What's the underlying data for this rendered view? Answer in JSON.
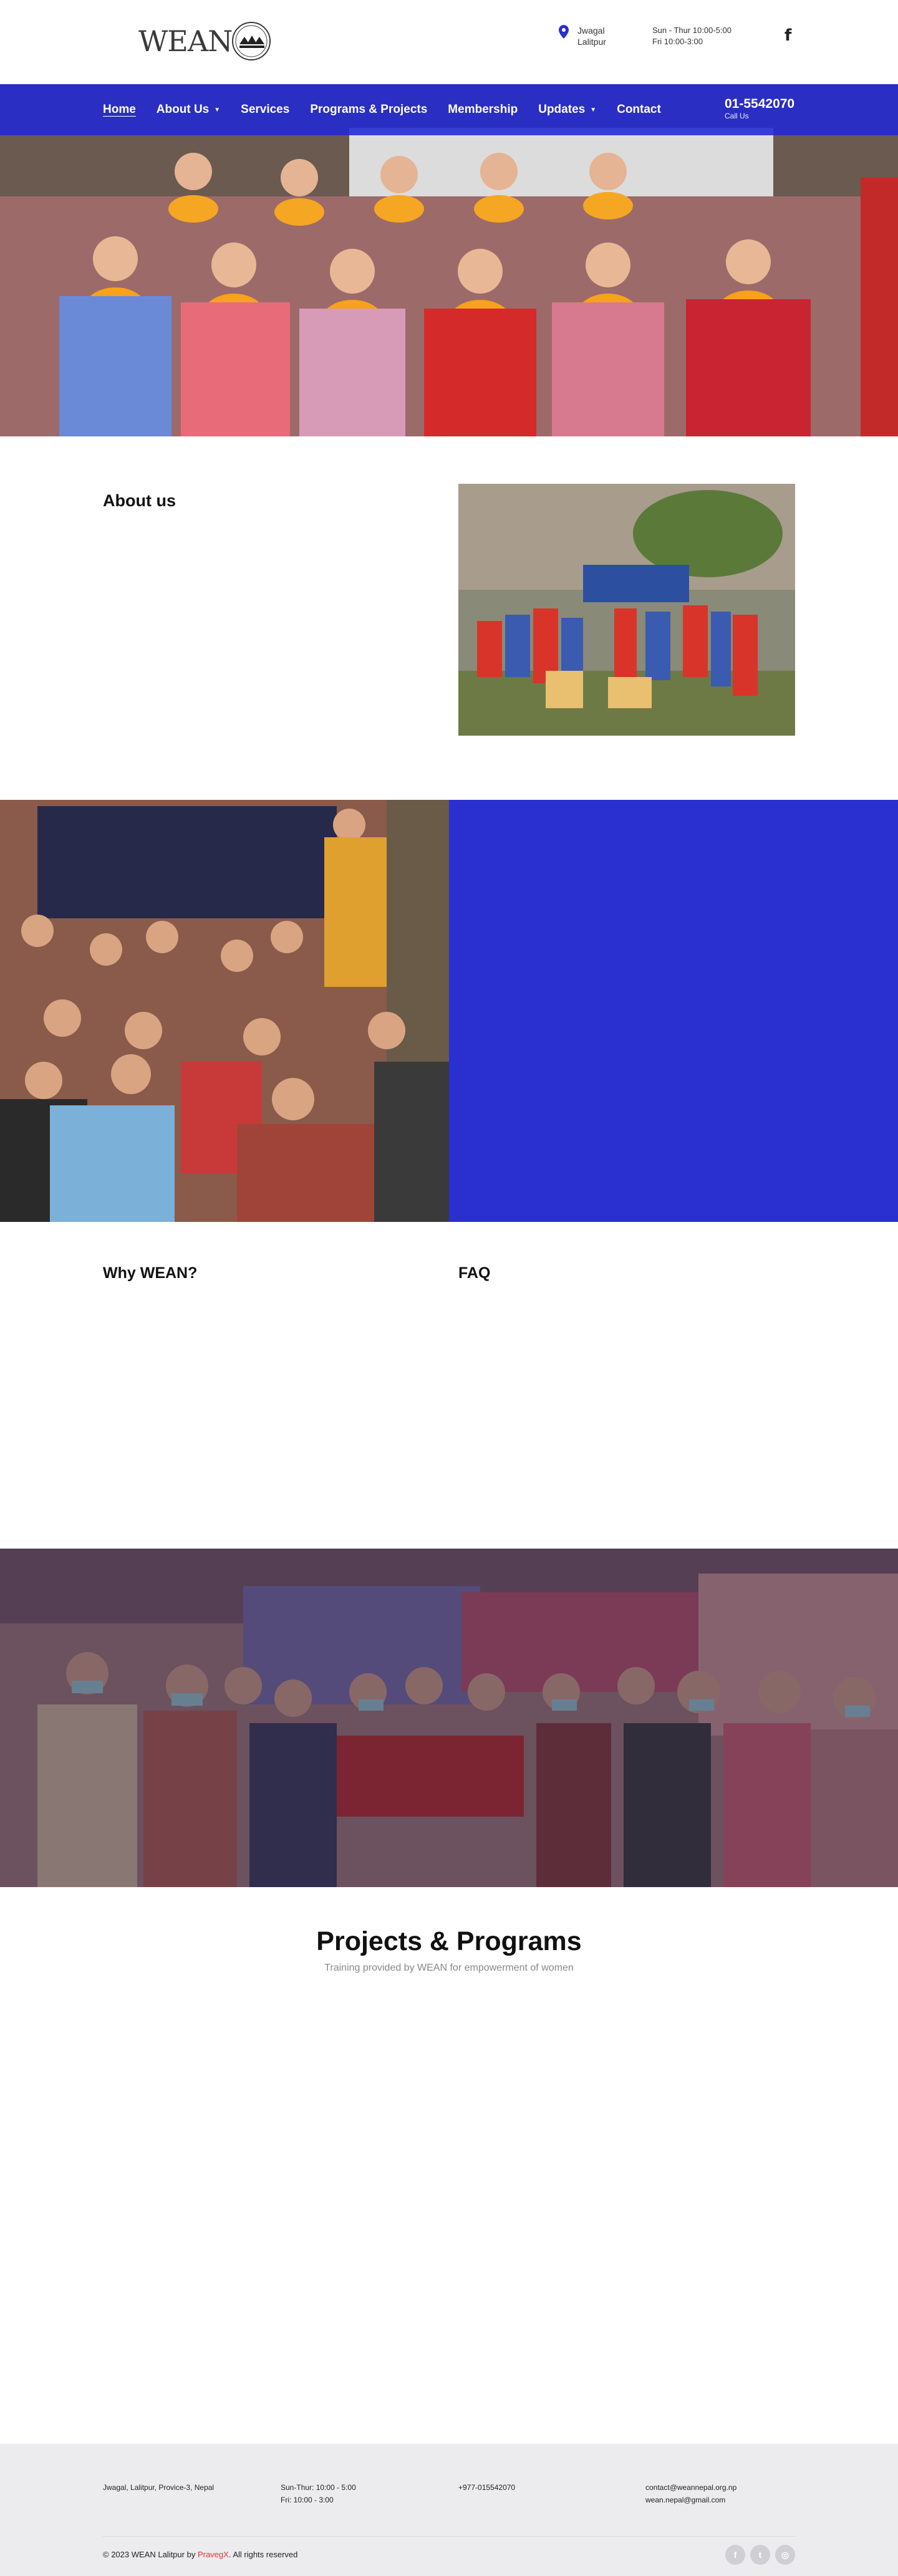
{
  "header": {
    "logo_text": "WEAN",
    "location_line1": "Jwagal",
    "location_line2": "Lalitpur",
    "hours_line1": "Sun - Thur 10:00-5:00",
    "hours_line2": "Fri 10:00-3:00",
    "social_icon": "facebook-icon"
  },
  "nav": {
    "items": [
      {
        "label": "Home",
        "active": true,
        "dropdown": false
      },
      {
        "label": "About Us",
        "active": false,
        "dropdown": true
      },
      {
        "label": "Services",
        "active": false,
        "dropdown": false
      },
      {
        "label": "Programs & Projects",
        "active": false,
        "dropdown": false
      },
      {
        "label": "Membership",
        "active": false,
        "dropdown": false
      },
      {
        "label": "Updates",
        "active": false,
        "dropdown": true
      },
      {
        "label": "Contact",
        "active": false,
        "dropdown": false
      }
    ],
    "phone": "01-5542070",
    "phone_label": "Call Us"
  },
  "about": {
    "title": "About us"
  },
  "why": {
    "title": "Why WEAN?"
  },
  "faq": {
    "title": "FAQ"
  },
  "projects": {
    "title": "Projects & Programs",
    "subtitle": "Training provided by WEAN for empowerment of women"
  },
  "footer": {
    "address": "Jwagal, Lalitpur, Provice-3, Nepal",
    "hours_line1": "Sun-Thur: 10:00 - 5:00",
    "hours_line2": "Fri: 10:00 - 3:00",
    "phone": "+977-015542070",
    "email1": "contact@weannepal.org.np",
    "email2": "wean.nepal@gmail.com",
    "copyright_prefix": "© 2023 WEAN Lalitpur by ",
    "copyright_brand": "PravegX",
    "copyright_suffix": ". All rights reserved",
    "social": [
      "facebook-icon",
      "twitter-icon",
      "instagram-icon"
    ]
  },
  "colors": {
    "brand_blue": "#2a2fd0",
    "accent_red": "#e0342f"
  }
}
